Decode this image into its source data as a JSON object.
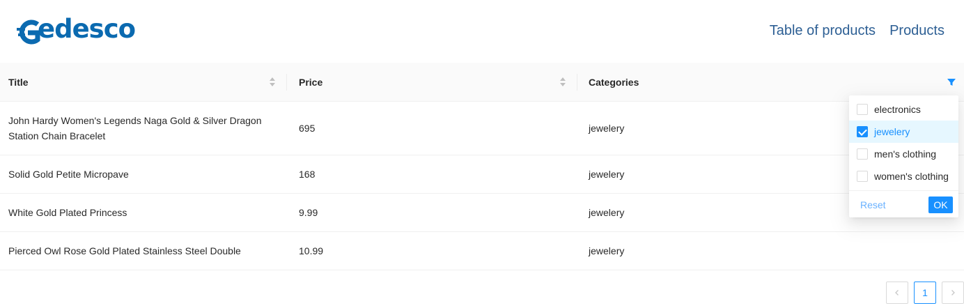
{
  "brand": {
    "logo_text": "Gedesco",
    "color": "#0b6ab0"
  },
  "nav": {
    "items": [
      {
        "label": "Table of products"
      },
      {
        "label": "Products"
      }
    ],
    "color": "#2d5f94"
  },
  "table": {
    "columns": [
      {
        "label": "Title",
        "sortable": true
      },
      {
        "label": "Price",
        "sortable": true
      },
      {
        "label": "Categories",
        "sortable": false,
        "filter_active": true
      }
    ],
    "rows": [
      {
        "title_line1": "John Hardy Women's Legends Naga Gold & Silver Dragon",
        "title_line2": "Station Chain Bracelet",
        "price": "695",
        "category": "jewelery"
      },
      {
        "title": "Solid Gold Petite Micropave",
        "price": "168",
        "category": "jewelery"
      },
      {
        "title": "White Gold Plated Princess",
        "price": "9.99",
        "category": "jewelery"
      },
      {
        "title": "Pierced Owl Rose Gold Plated Stainless Steel Double",
        "price": "10.99",
        "category": "jewelery"
      }
    ]
  },
  "filter_dropdown": {
    "options": [
      {
        "label": "electronics",
        "checked": false
      },
      {
        "label": "jewelery",
        "checked": true
      },
      {
        "label": "men's clothing",
        "checked": false
      },
      {
        "label": "women's clothing",
        "checked": false
      }
    ],
    "reset_label": "Reset",
    "ok_label": "OK"
  },
  "pagination": {
    "prev_icon": "chevron-left-icon",
    "current_page": "1",
    "next_icon": "chevron-right-icon"
  },
  "colors": {
    "accent": "#1890ff",
    "header_bg": "#fafafa"
  }
}
